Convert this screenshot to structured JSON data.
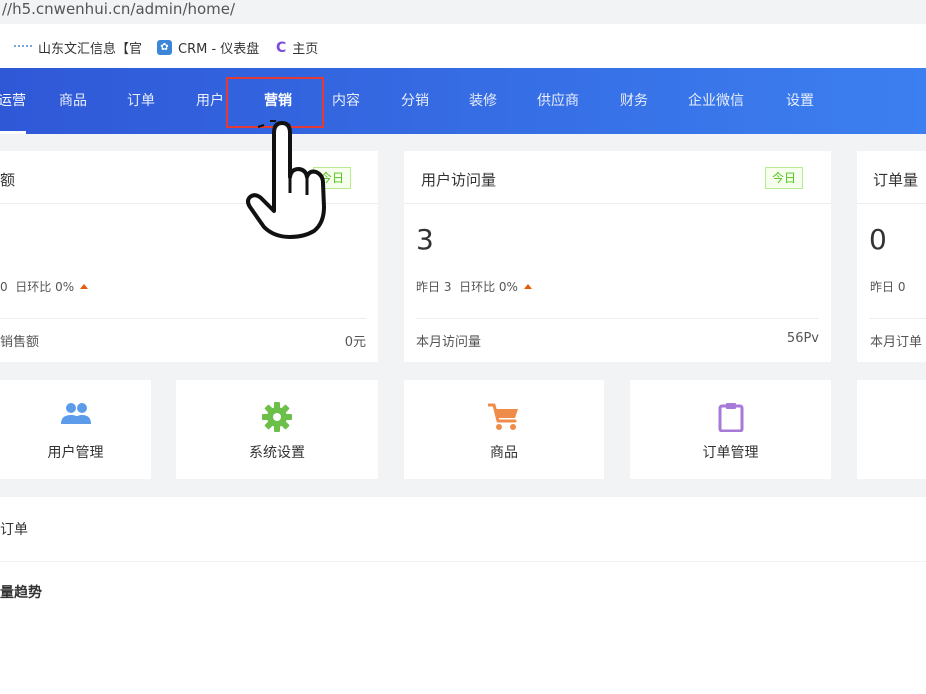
{
  "browser": {
    "url": "//h5.cnwenhui.cn/admin/home/",
    "bookmarks": [
      {
        "label": "山东文汇信息【官",
        "icon": "wave-icon"
      },
      {
        "label": "CRM - 仪表盘",
        "icon": "crm-icon"
      },
      {
        "label": "主页",
        "icon": "c-logo-icon"
      }
    ]
  },
  "nav": {
    "items": [
      "运营",
      "商品",
      "订单",
      "用户",
      "营销",
      "内容",
      "分销",
      "装修",
      "供应商",
      "财务",
      "企业微信",
      "设置"
    ],
    "active": "运营",
    "hovered": "营销",
    "colors": {
      "start": "#2f58d7",
      "end": "#3c7ff0"
    }
  },
  "stats": [
    {
      "title": "额",
      "tag": "今日",
      "value": "",
      "compare_prefix": "0",
      "compare": "日环比 0%",
      "footer_label": "销售额",
      "footer_value": "0元"
    },
    {
      "title": "用户访问量",
      "tag": "今日",
      "value": "3",
      "compare_prefix": "昨日 3",
      "compare": "日环比 0%",
      "footer_label": "本月访问量",
      "footer_value": "56Pv"
    },
    {
      "title": "订单量",
      "value": "0",
      "compare_prefix": "昨日 0",
      "footer_label": "本月订单"
    }
  ],
  "quick": [
    {
      "label": "用户管理",
      "icon": "users-icon",
      "color": "#5b9bea"
    },
    {
      "label": "系统设置",
      "icon": "gear-icon",
      "color": "#6cc04a"
    },
    {
      "label": "商品",
      "icon": "cart-icon",
      "color": "#f08c4a"
    },
    {
      "label": "订单管理",
      "icon": "clipboard-icon",
      "color": "#a77ad8"
    }
  ],
  "panels": {
    "orders_title": "订单",
    "trend_title": "量趋势"
  }
}
